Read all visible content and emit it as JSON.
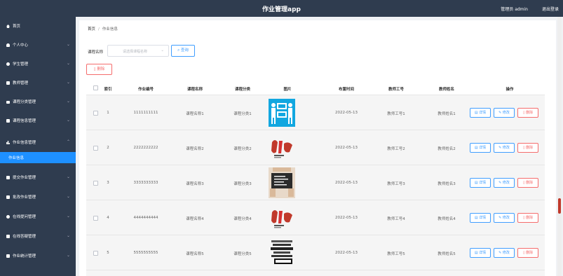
{
  "header": {
    "title": "作业管理app",
    "user": "管理员 admin",
    "logout": "退出登录"
  },
  "sidebar": {
    "items": [
      {
        "label": "首页",
        "icon": "home-icon"
      },
      {
        "label": "个人中心",
        "icon": "user-icon"
      },
      {
        "label": "学生管理",
        "icon": "students-icon"
      },
      {
        "label": "教师管理",
        "icon": "teacher-icon"
      },
      {
        "label": "课程分类管理",
        "icon": "list-icon"
      },
      {
        "label": "课程信息管理",
        "icon": "grid-icon"
      },
      {
        "label": "作业信息管理",
        "icon": "chart-icon"
      },
      {
        "label": "提交作业管理",
        "icon": "grid-icon"
      },
      {
        "label": "批改作业管理",
        "icon": "doc-icon"
      },
      {
        "label": "在线提问管理",
        "icon": "chat-icon"
      },
      {
        "label": "在线答疑管理",
        "icon": "grid-icon"
      },
      {
        "label": "作业统计管理",
        "icon": "grid-icon"
      }
    ],
    "submenu": "作业信息"
  },
  "breadcrumb": {
    "home": "首页",
    "separator": "/",
    "current": "作业信息"
  },
  "search": {
    "label": "课程名称",
    "placeholder": "请选择课程名称",
    "button": "查询"
  },
  "delete_button": "删除",
  "table": {
    "headers": [
      "索引",
      "作业编号",
      "课程名称",
      "课程分类",
      "图片",
      "布置时间",
      "教师工号",
      "教师姓名",
      "操作"
    ],
    "rows": [
      {
        "index": "1",
        "code": "1111111111",
        "course": "课程名称1",
        "category": "课程分类1",
        "image": "英语图片",
        "time": "2022-05-13",
        "teacher_id": "教师工号1",
        "teacher_name": "教师姓名1"
      },
      {
        "index": "2",
        "code": "2222222222",
        "course": "课程名称2",
        "category": "课程分类2",
        "image": "健身图片",
        "time": "2022-05-13",
        "teacher_id": "教师工号2",
        "teacher_name": "教师姓名2"
      },
      {
        "index": "3",
        "code": "3333333333",
        "course": "课程名称3",
        "category": "课程分类3",
        "image": "英语黑板图片",
        "time": "2022-05-13",
        "teacher_id": "教师工号3",
        "teacher_name": "教师姓名3"
      },
      {
        "index": "4",
        "code": "4444444444",
        "course": "课程名称4",
        "category": "课程分类4",
        "image": "健身图片",
        "time": "2022-05-13",
        "teacher_id": "教师工号4",
        "teacher_name": "教师姓名4"
      },
      {
        "index": "5",
        "code": "5555555555",
        "course": "课程名称5",
        "category": "课程分类5",
        "image": "words图片",
        "time": "2022-05-13",
        "teacher_id": "教师工号5",
        "teacher_name": "教师姓名5"
      }
    ],
    "actions": {
      "detail": "详情",
      "edit": "修改",
      "delete": "删除"
    }
  },
  "colors": {
    "sidebar": "#2f3c4f",
    "accent": "#1e90ff",
    "primary": "#409eff",
    "danger": "#f56c6c"
  }
}
